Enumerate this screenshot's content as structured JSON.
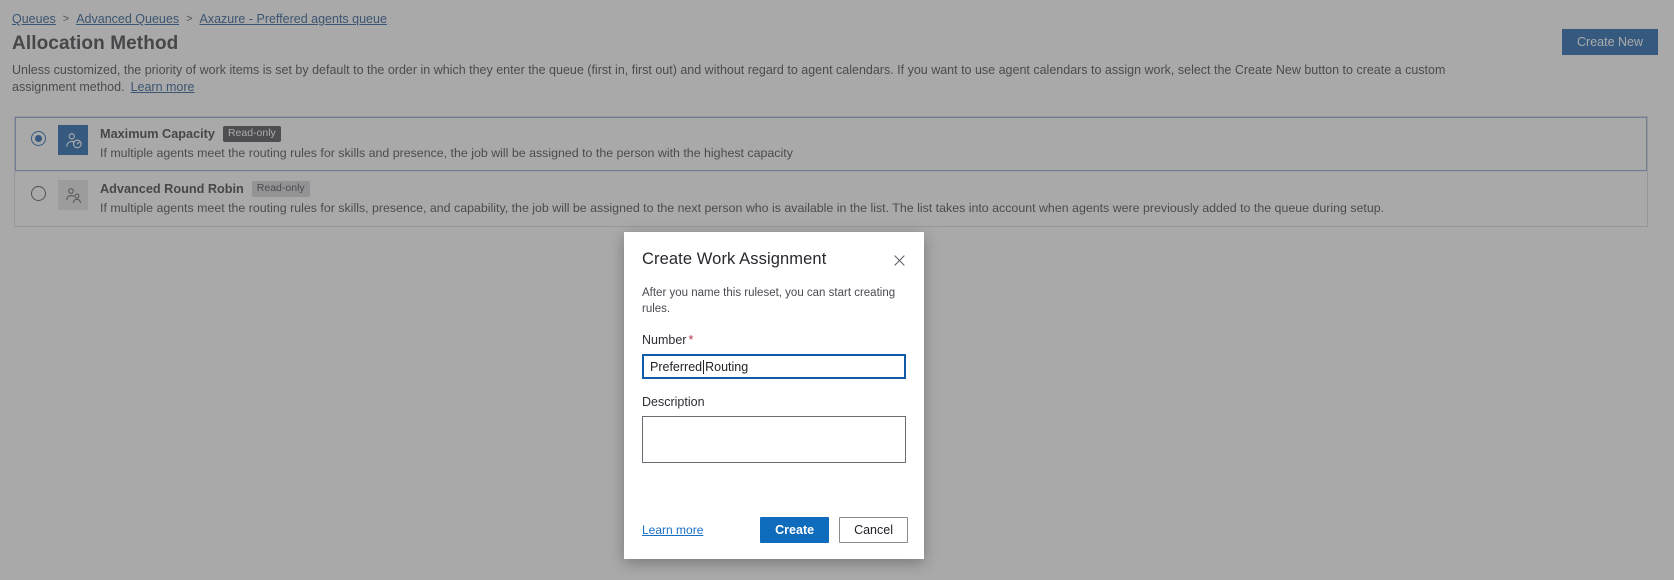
{
  "breadcrumb": {
    "items": [
      {
        "label": "Queues"
      },
      {
        "label": "Advanced Queues"
      },
      {
        "label": "Axazure - Preffered agents queue"
      }
    ],
    "separator": ">"
  },
  "header": {
    "title": "Allocation Method",
    "description": "Unless customized, the priority of work items is set by default to the order in which they enter the queue (first in, first out) and without regard to agent calendars. If you want to use agent calendars to assign work, select the Create New button to create a custom assignment method.",
    "learn_more": "Learn more",
    "create_new_label": "Create New",
    "accent_color": "#0f5ba7"
  },
  "options": [
    {
      "title": "Maximum Capacity",
      "badge": "Read-only",
      "description": "If multiple agents meet the routing rules for skills and presence, the job will be assigned to the person with the highest capacity",
      "selected": true,
      "icon": "person-capacity-icon"
    },
    {
      "title": "Advanced Round Robin",
      "badge": "Read-only",
      "description": "If multiple agents meet the routing rules for skills, presence, and capability, the job will be assigned to the next person who is available in the list. The list takes into account when agents were previously added to the queue during setup.",
      "selected": false,
      "icon": "person-group-icon"
    }
  ],
  "dialog": {
    "title": "Create Work Assignment",
    "subtitle": "After you name this ruleset, you can start creating rules.",
    "close_icon": "close-icon",
    "number_field": {
      "label": "Number",
      "required_marker": "*",
      "value_before_caret": "Preferred ",
      "value_after_caret": "Routing",
      "placeholder": ""
    },
    "description_field": {
      "label": "Description",
      "value": "",
      "placeholder": ""
    },
    "learn_more": "Learn more",
    "create_label": "Create",
    "cancel_label": "Cancel"
  }
}
